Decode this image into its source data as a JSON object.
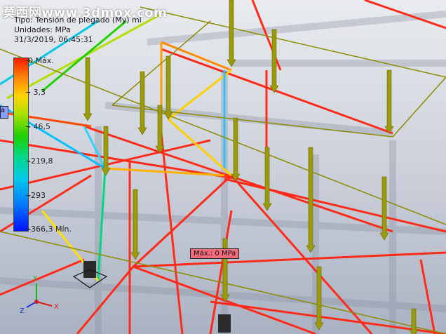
{
  "watermark": "莫西网www.3dmox.com",
  "overlay": {
    "line1": "Tipo: Tensión de plegado (My) mi",
    "line2": "Unidades: MPa",
    "line3": "31/3/2019, 06:45:31"
  },
  "legend": {
    "ticks": [
      "0 Máx.",
      "- 3,3",
      "- 46,5",
      "-219,8",
      "-293",
      "-366,3 Mín."
    ]
  },
  "callout": {
    "text": "Máx.: 0 MPa"
  },
  "side_tag": {
    "text": "a"
  },
  "axes": {
    "x": "X",
    "y": "Y",
    "z": "Z"
  },
  "colors": {
    "beam_high": "#ff2a1a",
    "beam_mid": "#ffb300",
    "arrow": "#9a9a0a",
    "legend_max": "#ff1a00",
    "legend_min": "#0010ff"
  }
}
